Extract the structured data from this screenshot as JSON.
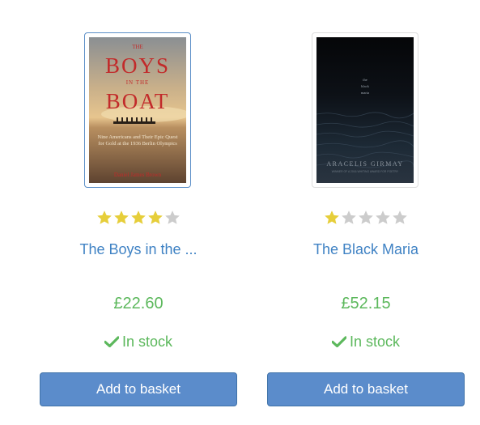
{
  "products": [
    {
      "title": "The Boys in the ...",
      "price": "£22.60",
      "rating": 4,
      "rating_max": 5,
      "availability": "In stock",
      "add_label": "Add to basket",
      "cover": {
        "lines": [
          "THE",
          "BOYS",
          "IN THE",
          "BOAT"
        ],
        "subtitle": "Nine Americans and Their Epic Quest for Gold at the 1936 Berlin Olympics",
        "author": "Daniel James Brown"
      }
    },
    {
      "title": "The Black Maria",
      "price": "£52.15",
      "rating": 1,
      "rating_max": 5,
      "availability": "In stock",
      "add_label": "Add to basket",
      "cover": {
        "lines": [
          "the",
          "black",
          "maria"
        ],
        "author": "ARACELIS GIRMAY",
        "tagline": "WINNER OF A 2016 WHITING AWARD FOR POETRY"
      }
    }
  ],
  "colors": {
    "link": "#3f82c4",
    "price": "#5cb85c",
    "stock": "#5cb85c",
    "button": "#5b8ccb",
    "star_on": "#e6ce3a",
    "star_off": "#cccccc"
  },
  "icons": {
    "star": "star-icon",
    "check": "check-icon"
  }
}
